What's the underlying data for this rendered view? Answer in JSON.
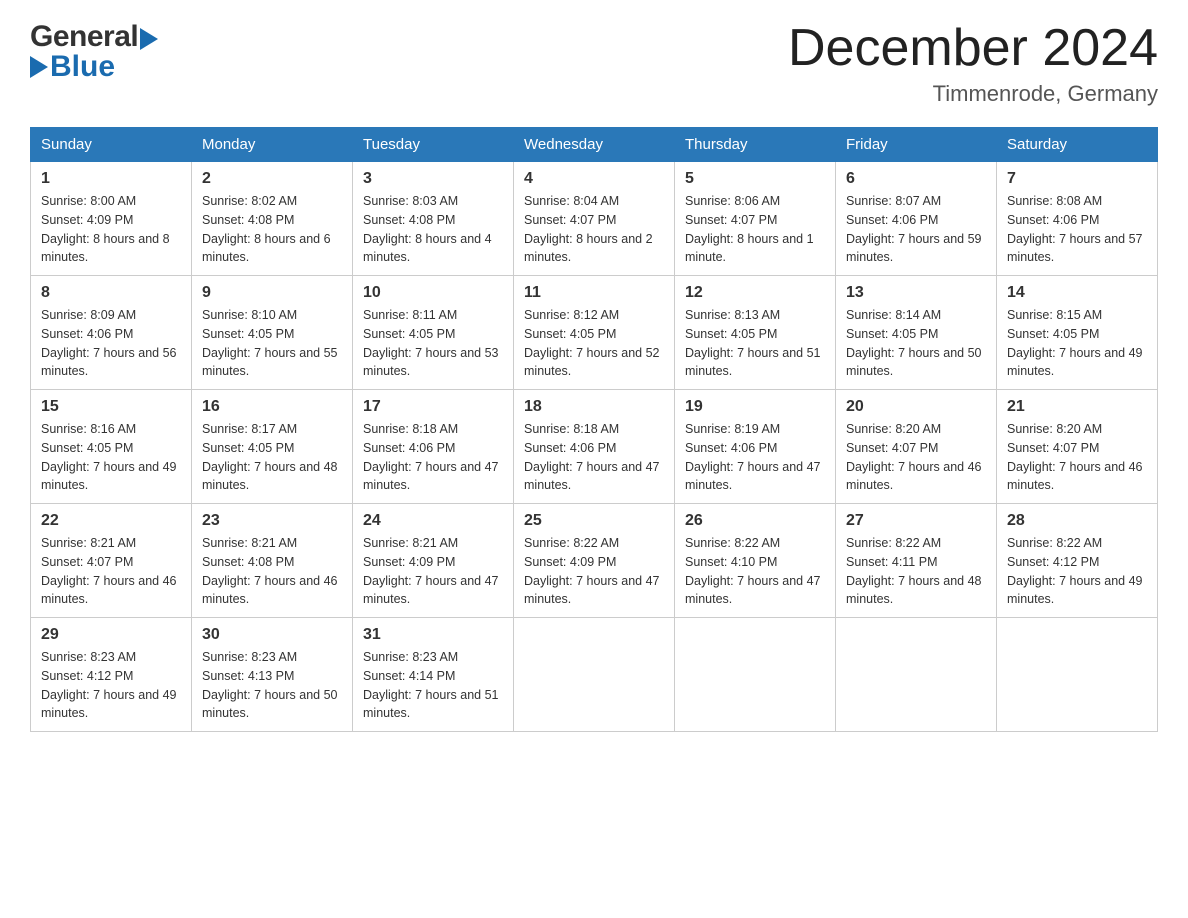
{
  "header": {
    "logo_general": "General",
    "logo_blue": "Blue",
    "month": "December 2024",
    "location": "Timmenrode, Germany"
  },
  "weekdays": [
    "Sunday",
    "Monday",
    "Tuesday",
    "Wednesday",
    "Thursday",
    "Friday",
    "Saturday"
  ],
  "weeks": [
    [
      {
        "day": 1,
        "sunrise": "8:00 AM",
        "sunset": "4:09 PM",
        "daylight": "8 hours and 8 minutes."
      },
      {
        "day": 2,
        "sunrise": "8:02 AM",
        "sunset": "4:08 PM",
        "daylight": "8 hours and 6 minutes."
      },
      {
        "day": 3,
        "sunrise": "8:03 AM",
        "sunset": "4:08 PM",
        "daylight": "8 hours and 4 minutes."
      },
      {
        "day": 4,
        "sunrise": "8:04 AM",
        "sunset": "4:07 PM",
        "daylight": "8 hours and 2 minutes."
      },
      {
        "day": 5,
        "sunrise": "8:06 AM",
        "sunset": "4:07 PM",
        "daylight": "8 hours and 1 minute."
      },
      {
        "day": 6,
        "sunrise": "8:07 AM",
        "sunset": "4:06 PM",
        "daylight": "7 hours and 59 minutes."
      },
      {
        "day": 7,
        "sunrise": "8:08 AM",
        "sunset": "4:06 PM",
        "daylight": "7 hours and 57 minutes."
      }
    ],
    [
      {
        "day": 8,
        "sunrise": "8:09 AM",
        "sunset": "4:06 PM",
        "daylight": "7 hours and 56 minutes."
      },
      {
        "day": 9,
        "sunrise": "8:10 AM",
        "sunset": "4:05 PM",
        "daylight": "7 hours and 55 minutes."
      },
      {
        "day": 10,
        "sunrise": "8:11 AM",
        "sunset": "4:05 PM",
        "daylight": "7 hours and 53 minutes."
      },
      {
        "day": 11,
        "sunrise": "8:12 AM",
        "sunset": "4:05 PM",
        "daylight": "7 hours and 52 minutes."
      },
      {
        "day": 12,
        "sunrise": "8:13 AM",
        "sunset": "4:05 PM",
        "daylight": "7 hours and 51 minutes."
      },
      {
        "day": 13,
        "sunrise": "8:14 AM",
        "sunset": "4:05 PM",
        "daylight": "7 hours and 50 minutes."
      },
      {
        "day": 14,
        "sunrise": "8:15 AM",
        "sunset": "4:05 PM",
        "daylight": "7 hours and 49 minutes."
      }
    ],
    [
      {
        "day": 15,
        "sunrise": "8:16 AM",
        "sunset": "4:05 PM",
        "daylight": "7 hours and 49 minutes."
      },
      {
        "day": 16,
        "sunrise": "8:17 AM",
        "sunset": "4:05 PM",
        "daylight": "7 hours and 48 minutes."
      },
      {
        "day": 17,
        "sunrise": "8:18 AM",
        "sunset": "4:06 PM",
        "daylight": "7 hours and 47 minutes."
      },
      {
        "day": 18,
        "sunrise": "8:18 AM",
        "sunset": "4:06 PM",
        "daylight": "7 hours and 47 minutes."
      },
      {
        "day": 19,
        "sunrise": "8:19 AM",
        "sunset": "4:06 PM",
        "daylight": "7 hours and 47 minutes."
      },
      {
        "day": 20,
        "sunrise": "8:20 AM",
        "sunset": "4:07 PM",
        "daylight": "7 hours and 46 minutes."
      },
      {
        "day": 21,
        "sunrise": "8:20 AM",
        "sunset": "4:07 PM",
        "daylight": "7 hours and 46 minutes."
      }
    ],
    [
      {
        "day": 22,
        "sunrise": "8:21 AM",
        "sunset": "4:07 PM",
        "daylight": "7 hours and 46 minutes."
      },
      {
        "day": 23,
        "sunrise": "8:21 AM",
        "sunset": "4:08 PM",
        "daylight": "7 hours and 46 minutes."
      },
      {
        "day": 24,
        "sunrise": "8:21 AM",
        "sunset": "4:09 PM",
        "daylight": "7 hours and 47 minutes."
      },
      {
        "day": 25,
        "sunrise": "8:22 AM",
        "sunset": "4:09 PM",
        "daylight": "7 hours and 47 minutes."
      },
      {
        "day": 26,
        "sunrise": "8:22 AM",
        "sunset": "4:10 PM",
        "daylight": "7 hours and 47 minutes."
      },
      {
        "day": 27,
        "sunrise": "8:22 AM",
        "sunset": "4:11 PM",
        "daylight": "7 hours and 48 minutes."
      },
      {
        "day": 28,
        "sunrise": "8:22 AM",
        "sunset": "4:12 PM",
        "daylight": "7 hours and 49 minutes."
      }
    ],
    [
      {
        "day": 29,
        "sunrise": "8:23 AM",
        "sunset": "4:12 PM",
        "daylight": "7 hours and 49 minutes."
      },
      {
        "day": 30,
        "sunrise": "8:23 AM",
        "sunset": "4:13 PM",
        "daylight": "7 hours and 50 minutes."
      },
      {
        "day": 31,
        "sunrise": "8:23 AM",
        "sunset": "4:14 PM",
        "daylight": "7 hours and 51 minutes."
      },
      null,
      null,
      null,
      null
    ]
  ]
}
